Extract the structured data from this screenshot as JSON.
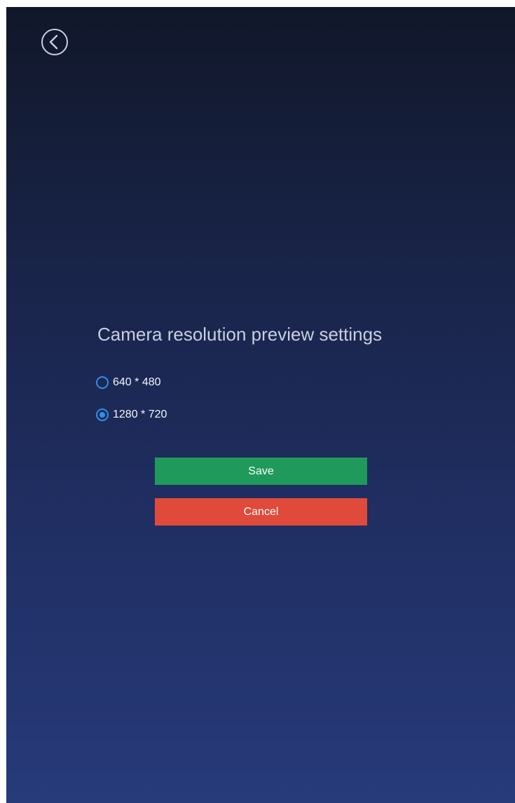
{
  "header": {
    "back_icon": "back-arrow-circle-icon"
  },
  "settings": {
    "title": "Camera resolution preview settings",
    "options": [
      {
        "label": "640 * 480",
        "selected": false
      },
      {
        "label": "1280 * 720",
        "selected": true
      }
    ]
  },
  "actions": {
    "save_label": "Save",
    "cancel_label": "Cancel"
  },
  "colors": {
    "accent": "#2f8fe8",
    "save": "#1f9a5b",
    "cancel": "#e04a3a"
  }
}
